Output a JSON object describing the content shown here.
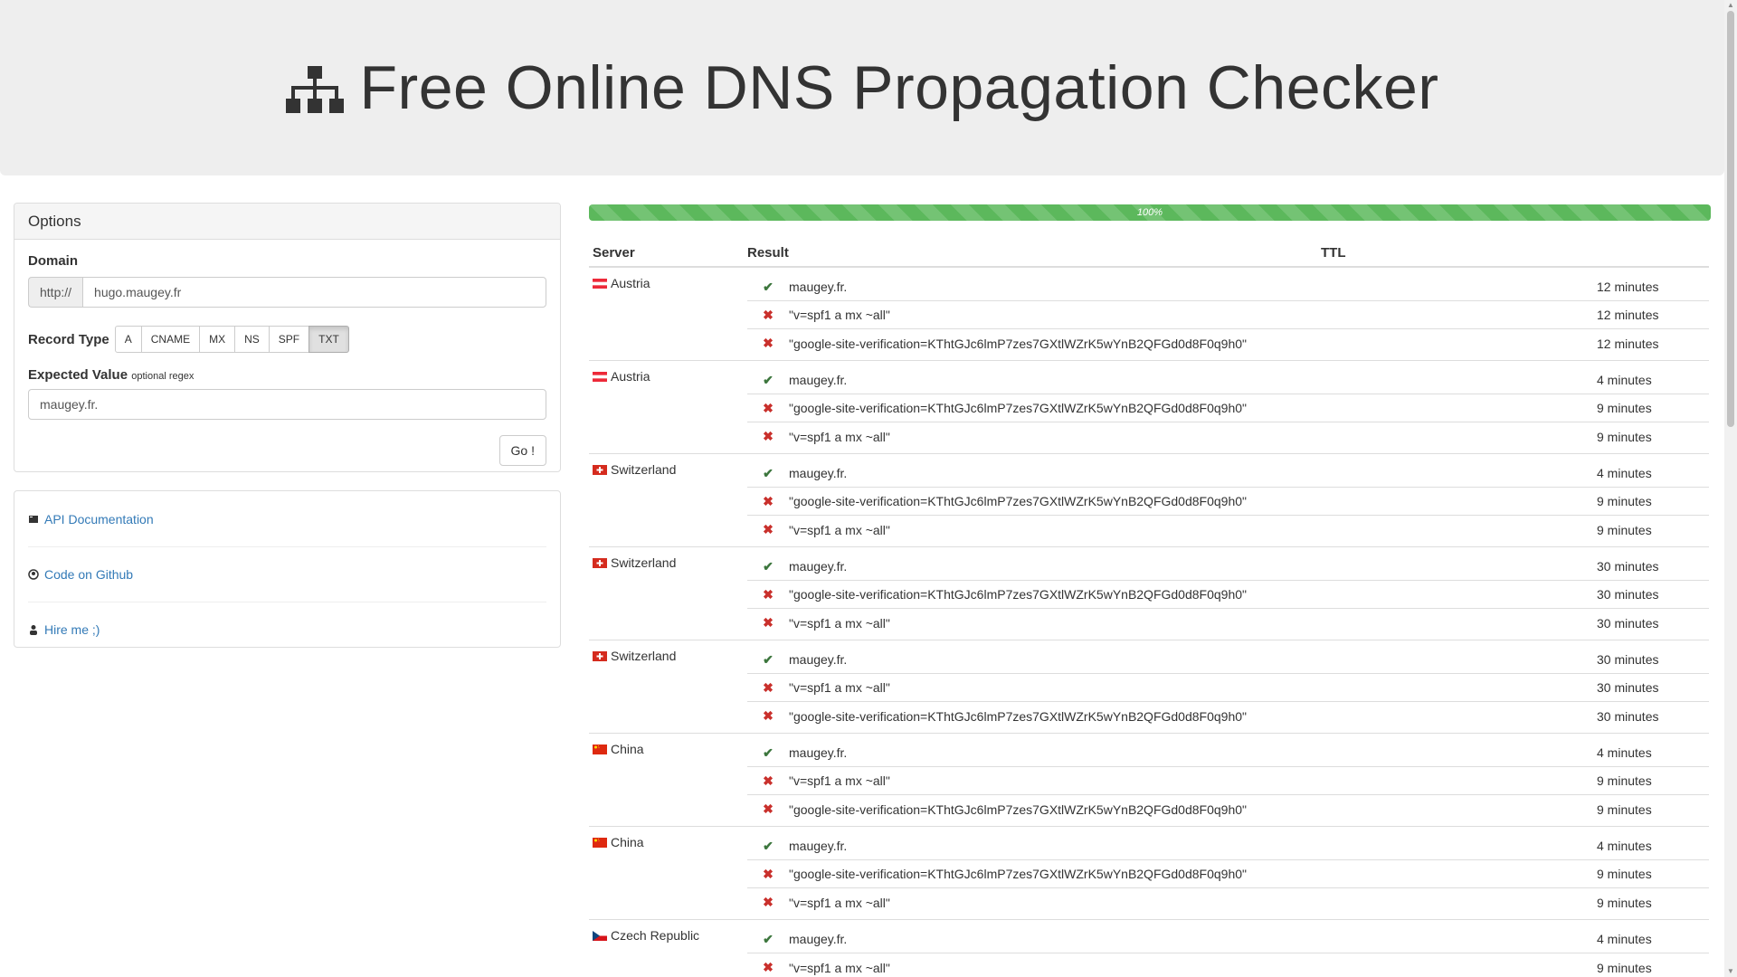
{
  "header": {
    "title": "Free Online DNS Propagation Checker",
    "icon": "sitemap-icon"
  },
  "options": {
    "heading": "Options",
    "domain_label": "Domain",
    "domain_prefix": "http://",
    "domain_value": "hugo.maugey.fr",
    "record_type_label": "Record Type",
    "record_types": [
      "A",
      "CNAME",
      "MX",
      "NS",
      "SPF",
      "TXT"
    ],
    "record_type_selected": "TXT",
    "expected_label": "Expected Value",
    "expected_hint": "optional regex",
    "expected_value": "maugey.fr.",
    "go_label": "Go !"
  },
  "links": [
    {
      "icon": "book-icon",
      "label": "API Documentation"
    },
    {
      "icon": "github-icon",
      "label": "Code on Github"
    },
    {
      "icon": "user-icon",
      "label": "Hire me ;)"
    }
  ],
  "progress": {
    "value": 1.0,
    "label": "100%",
    "color": "#5cb85c"
  },
  "table": {
    "headers": {
      "server": "Server",
      "result": "Result",
      "ttl": "TTL"
    },
    "groups": [
      {
        "country": "Austria",
        "flag": "austria-flag",
        "records": [
          {
            "ok": true,
            "value": "maugey.fr.",
            "ttl": "12 minutes"
          },
          {
            "ok": false,
            "value": "\"v=spf1 a mx ~all\"",
            "ttl": "12 minutes"
          },
          {
            "ok": false,
            "value": "\"google-site-verification=KThtGJc6lmP7zes7GXtlWZrK5wYnB2QFGd0d8F0q9h0\"",
            "ttl": "12 minutes"
          }
        ]
      },
      {
        "country": "Austria",
        "flag": "austria-flag",
        "records": [
          {
            "ok": true,
            "value": "maugey.fr.",
            "ttl": "4 minutes"
          },
          {
            "ok": false,
            "value": "\"google-site-verification=KThtGJc6lmP7zes7GXtlWZrK5wYnB2QFGd0d8F0q9h0\"",
            "ttl": "9 minutes"
          },
          {
            "ok": false,
            "value": "\"v=spf1 a mx ~all\"",
            "ttl": "9 minutes"
          }
        ]
      },
      {
        "country": "Switzerland",
        "flag": "switzerland-flag",
        "records": [
          {
            "ok": true,
            "value": "maugey.fr.",
            "ttl": "4 minutes"
          },
          {
            "ok": false,
            "value": "\"google-site-verification=KThtGJc6lmP7zes7GXtlWZrK5wYnB2QFGd0d8F0q9h0\"",
            "ttl": "9 minutes"
          },
          {
            "ok": false,
            "value": "\"v=spf1 a mx ~all\"",
            "ttl": "9 minutes"
          }
        ]
      },
      {
        "country": "Switzerland",
        "flag": "switzerland-flag",
        "records": [
          {
            "ok": true,
            "value": "maugey.fr.",
            "ttl": "30 minutes"
          },
          {
            "ok": false,
            "value": "\"google-site-verification=KThtGJc6lmP7zes7GXtlWZrK5wYnB2QFGd0d8F0q9h0\"",
            "ttl": "30 minutes"
          },
          {
            "ok": false,
            "value": "\"v=spf1 a mx ~all\"",
            "ttl": "30 minutes"
          }
        ]
      },
      {
        "country": "Switzerland",
        "flag": "switzerland-flag",
        "records": [
          {
            "ok": true,
            "value": "maugey.fr.",
            "ttl": "30 minutes"
          },
          {
            "ok": false,
            "value": "\"v=spf1 a mx ~all\"",
            "ttl": "30 minutes"
          },
          {
            "ok": false,
            "value": "\"google-site-verification=KThtGJc6lmP7zes7GXtlWZrK5wYnB2QFGd0d8F0q9h0\"",
            "ttl": "30 minutes"
          }
        ]
      },
      {
        "country": "China",
        "flag": "china-flag",
        "records": [
          {
            "ok": true,
            "value": "maugey.fr.",
            "ttl": "4 minutes"
          },
          {
            "ok": false,
            "value": "\"v=spf1 a mx ~all\"",
            "ttl": "9 minutes"
          },
          {
            "ok": false,
            "value": "\"google-site-verification=KThtGJc6lmP7zes7GXtlWZrK5wYnB2QFGd0d8F0q9h0\"",
            "ttl": "9 minutes"
          }
        ]
      },
      {
        "country": "China",
        "flag": "china-flag",
        "records": [
          {
            "ok": true,
            "value": "maugey.fr.",
            "ttl": "4 minutes"
          },
          {
            "ok": false,
            "value": "\"google-site-verification=KThtGJc6lmP7zes7GXtlWZrK5wYnB2QFGd0d8F0q9h0\"",
            "ttl": "9 minutes"
          },
          {
            "ok": false,
            "value": "\"v=spf1 a mx ~all\"",
            "ttl": "9 minutes"
          }
        ]
      },
      {
        "country": "Czech Republic",
        "flag": "czech-flag",
        "records": [
          {
            "ok": true,
            "value": "maugey.fr.",
            "ttl": "4 minutes"
          },
          {
            "ok": false,
            "value": "\"v=spf1 a mx ~all\"",
            "ttl": "9 minutes"
          }
        ]
      }
    ]
  }
}
